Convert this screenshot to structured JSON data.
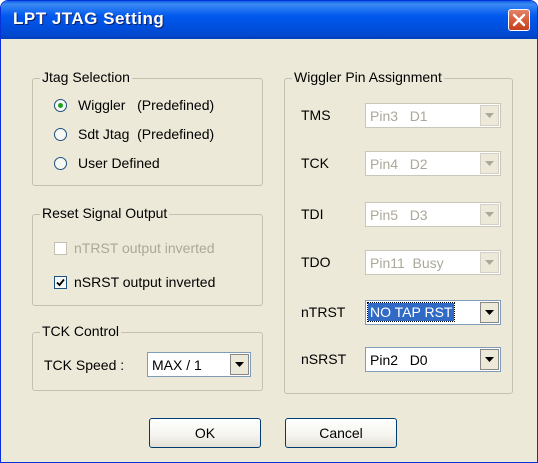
{
  "window": {
    "title": "LPT JTAG Setting"
  },
  "jtag_selection": {
    "title": "Jtag Selection",
    "options": [
      {
        "label": "Wiggler   (Predefined)",
        "selected": true
      },
      {
        "label": "Sdt Jtag  (Predefined)",
        "selected": false
      },
      {
        "label": "User Defined",
        "selected": false
      }
    ]
  },
  "reset_signal": {
    "title": "Reset Signal Output",
    "ntrst_label": "nTRST output inverted",
    "ntrst_checked": false,
    "ntrst_enabled": false,
    "nsrst_label": "nSRST output inverted",
    "nsrst_checked": true
  },
  "tck_control": {
    "title": "TCK Control",
    "speed_label": "TCK Speed :",
    "speed_value": "MAX / 1"
  },
  "wiggler": {
    "title": "Wiggler Pin Assignment",
    "pins": [
      {
        "name": "TMS",
        "value": "Pin3   D1",
        "enabled": false
      },
      {
        "name": "TCK",
        "value": "Pin4   D2",
        "enabled": false
      },
      {
        "name": "TDI",
        "value": "Pin5   D3",
        "enabled": false
      },
      {
        "name": "TDO",
        "value": "Pin11  Busy",
        "enabled": false
      },
      {
        "name": "nTRST",
        "value": "NO TAP RST",
        "enabled": true,
        "highlighted": true
      },
      {
        "name": "nSRST",
        "value": "Pin2   D0",
        "enabled": true
      }
    ]
  },
  "buttons": {
    "ok": "OK",
    "cancel": "Cancel"
  },
  "colors": {
    "titlebar": "#0058ee",
    "dialog": "#ece9d8",
    "selection": "#316ac5",
    "close": "#d55a38"
  },
  "icons": {
    "close": "close-x-icon",
    "dropdown": "dropdown-arrow-icon",
    "check": "checkmark-icon"
  }
}
